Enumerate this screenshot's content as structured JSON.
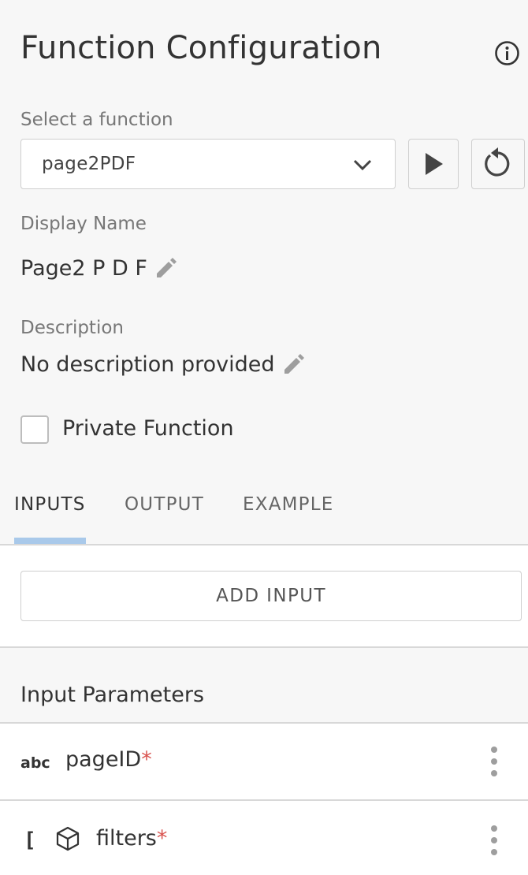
{
  "header": {
    "title": "Function Configuration",
    "info_icon": "info-circle-icon"
  },
  "function_select": {
    "label": "Select a function",
    "value": "page2PDF",
    "icon": "chevron-down-icon",
    "run_icon": "play-icon",
    "reset_icon": "refresh-icon"
  },
  "display_name": {
    "label": "Display Name",
    "value": "Page2 P D F",
    "edit_icon": "pencil-icon"
  },
  "description": {
    "label": "Description",
    "value": "No description provided",
    "edit_icon": "pencil-icon"
  },
  "private_function": {
    "label": "Private Function",
    "checked": false
  },
  "tabs": [
    {
      "label": "INPUTS",
      "active": true
    },
    {
      "label": "OUTPUT",
      "active": false
    },
    {
      "label": "EXAMPLE",
      "active": false
    }
  ],
  "add_input": {
    "label": "ADD INPUT"
  },
  "parameters": {
    "title": "Input Parameters",
    "items": [
      {
        "name": "pageID",
        "required_mark": "*",
        "type_icon": "text-type-icon",
        "type_text": "abc"
      },
      {
        "name": "filters",
        "required_mark": "*",
        "type_icon": "object-array-icon",
        "array_text": "[ ]"
      }
    ]
  },
  "colors": {
    "accent": "#a9c9ea",
    "required": "#d9534f",
    "background": "#f7f7f7",
    "border": "#cfcfcf"
  }
}
